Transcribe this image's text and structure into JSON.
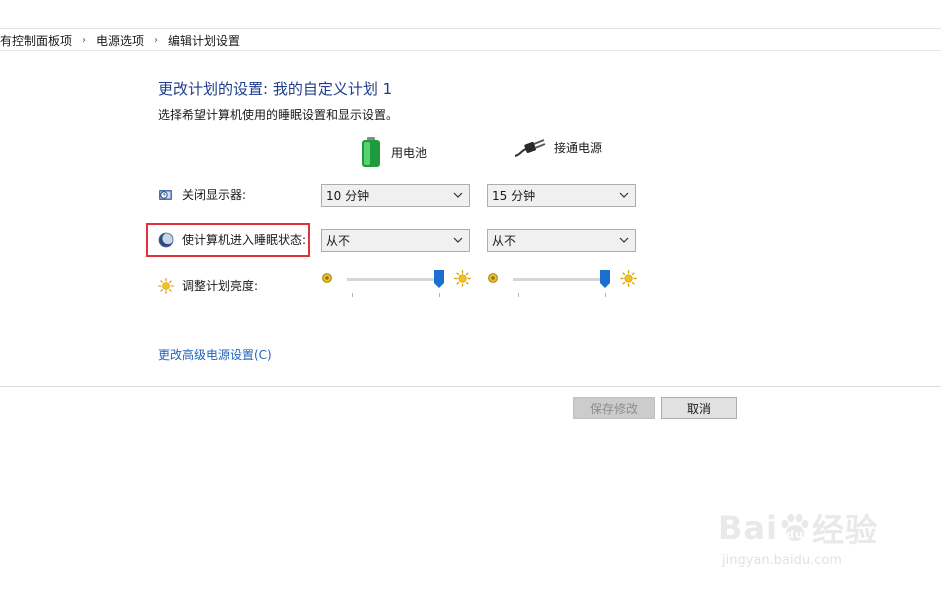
{
  "breadcrumb": {
    "items": [
      "有控制面板项",
      "电源选项",
      "编辑计划设置"
    ]
  },
  "header": {
    "title": "更改计划的设置: 我的自定义计划 1",
    "subtitle": "选择希望计算机使用的睡眠设置和显示设置。"
  },
  "columns": {
    "battery": {
      "label": "用电池",
      "icon": "battery-icon"
    },
    "plugged": {
      "label": "接通电源",
      "icon": "power-plug-icon"
    }
  },
  "settings": {
    "display_off": {
      "label": "关闭显示器:",
      "icon": "monitor-clock-icon",
      "battery_value": "10 分钟",
      "plugged_value": "15 分钟"
    },
    "sleep": {
      "label": "使计算机进入睡眠状态:",
      "icon": "moon-icon",
      "battery_value": "从不",
      "plugged_value": "从不"
    },
    "brightness": {
      "label": "调整计划亮度:",
      "icon": "sun-icon",
      "battery_level_percent": 100,
      "plugged_level_percent": 100
    }
  },
  "links": {
    "advanced": "更改高级电源设置(C)"
  },
  "buttons": {
    "save": "保存修改",
    "cancel": "取消"
  },
  "watermark": {
    "main": "Bai",
    "main2": "经验",
    "sub": "jingyan.baidu.com"
  },
  "colors": {
    "title": "#1e3c8c",
    "link": "#1e63b8",
    "slider_thumb": "#1a6fd0",
    "highlight": "#e0323b",
    "battery": "#2bb24c"
  }
}
